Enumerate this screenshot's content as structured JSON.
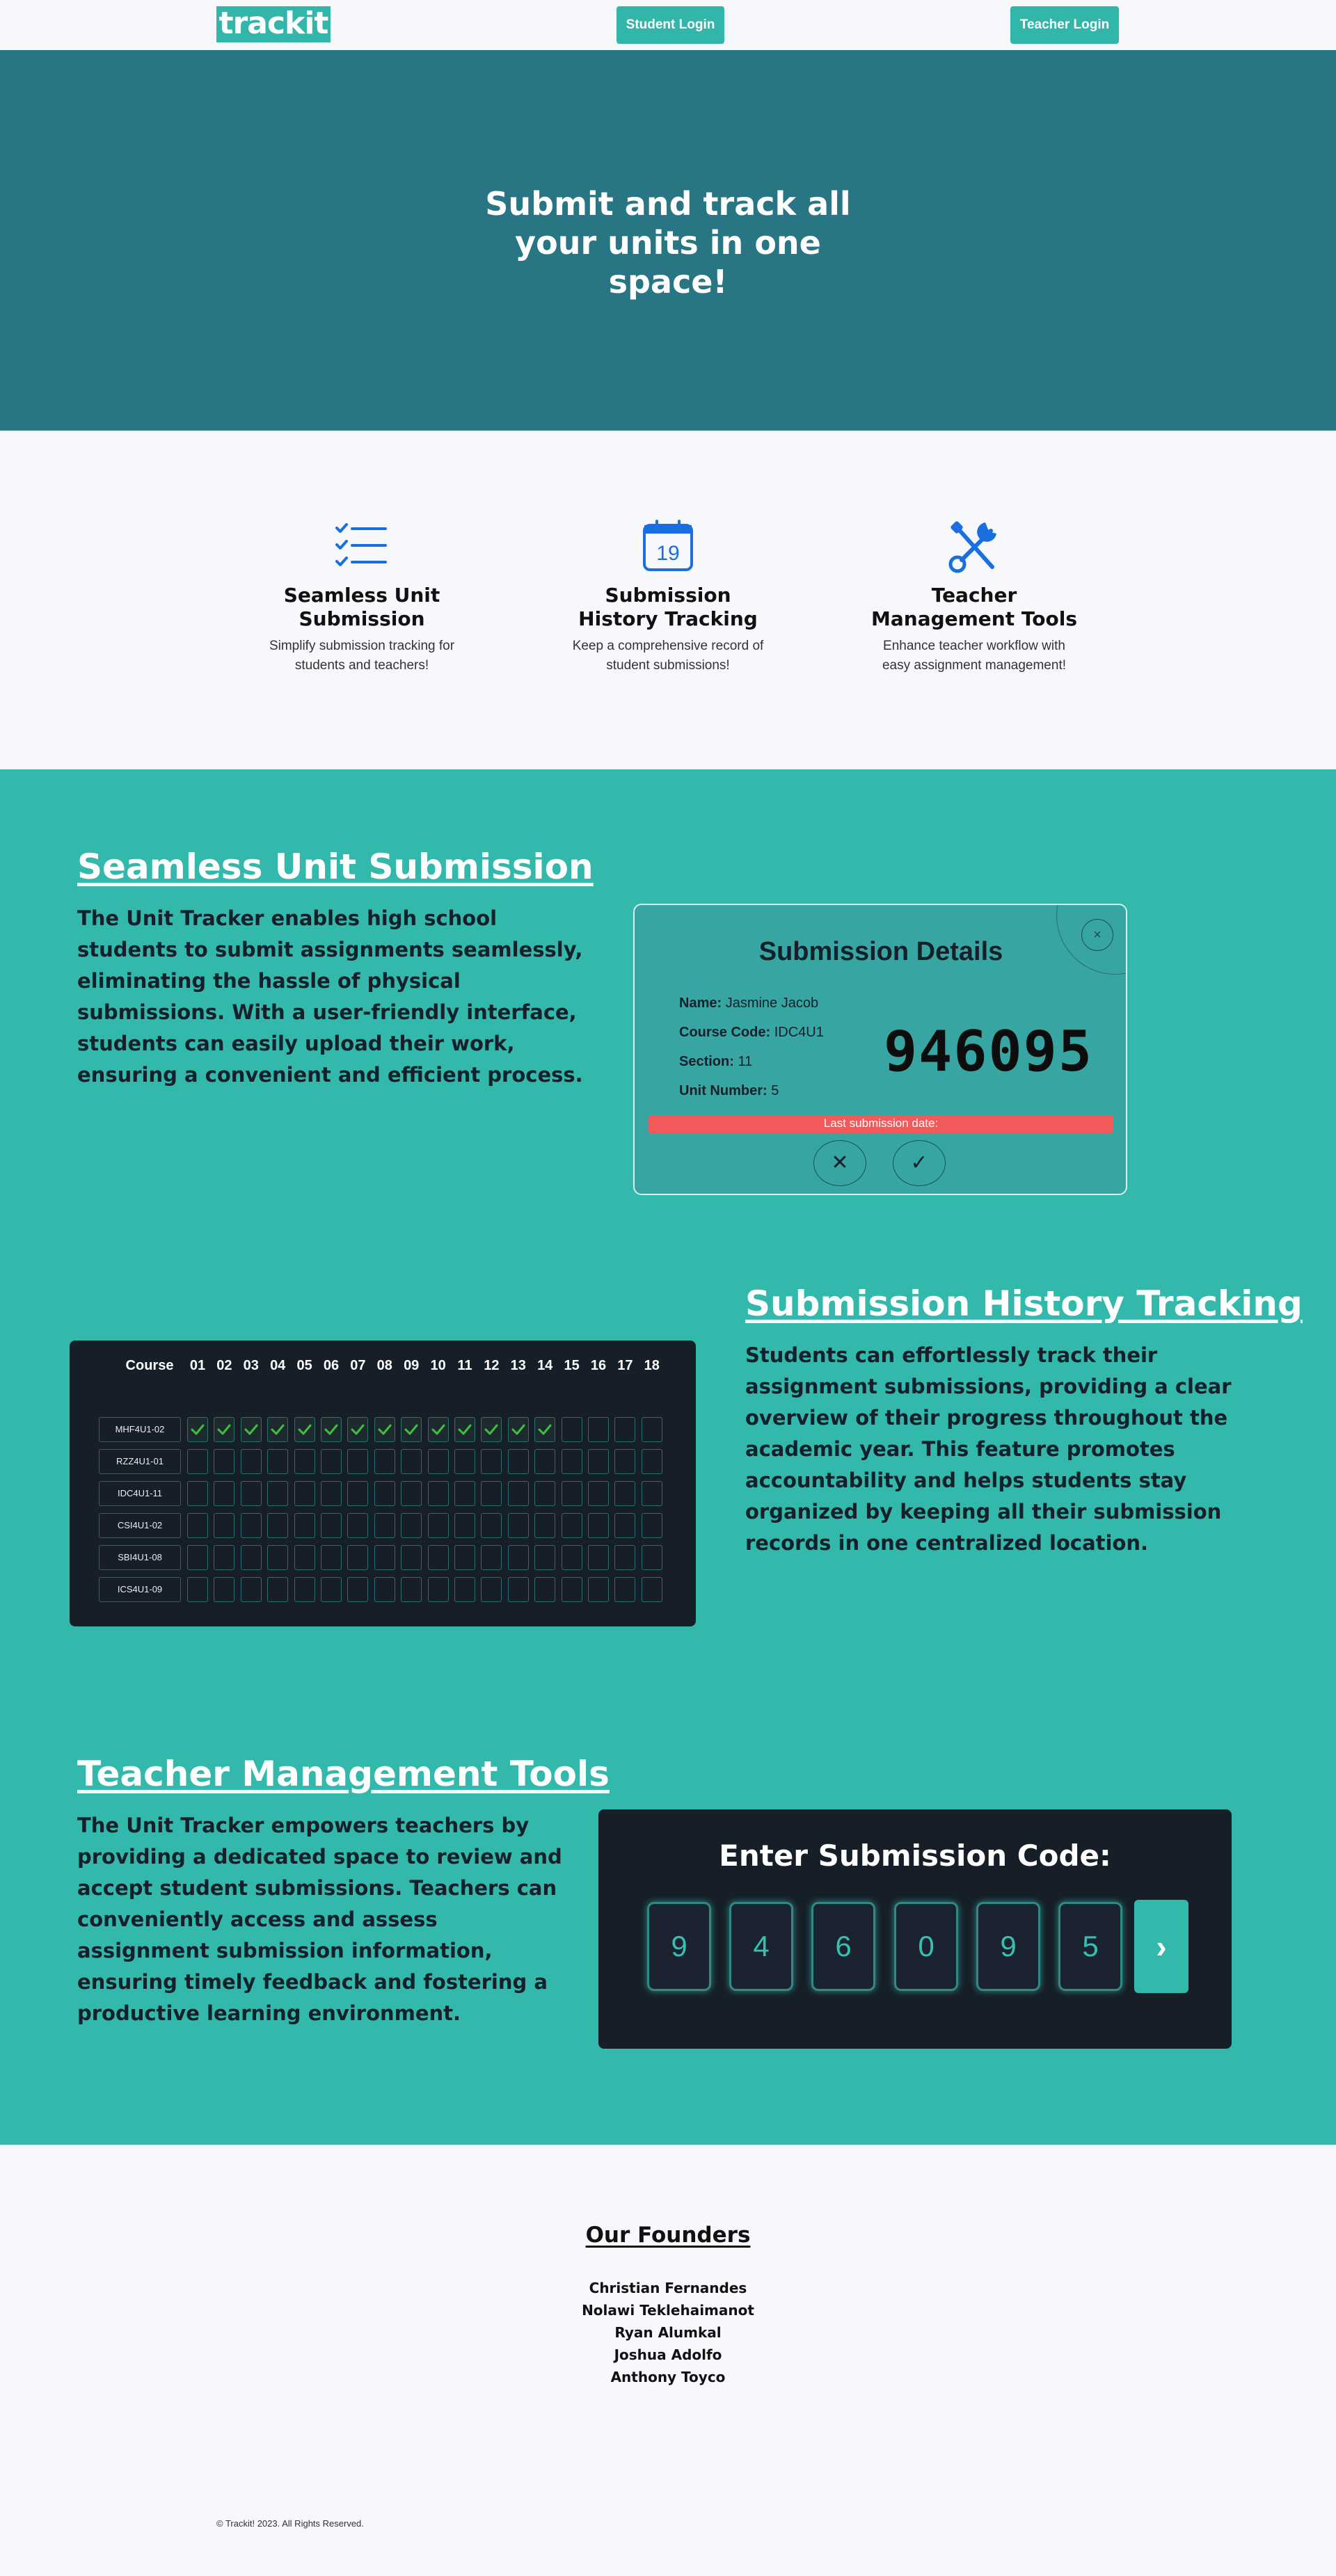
{
  "nav": {
    "logo": "trackit",
    "student_login": "Student Login",
    "teacher_login": "Teacher Login"
  },
  "hero": {
    "title": "Submit and track all your units in one space!"
  },
  "features": [
    {
      "icon": "checklist-icon",
      "title": "Seamless Unit Submission",
      "desc": "Simplify submission tracking for students and teachers!"
    },
    {
      "icon": "calendar-icon",
      "title": "Submission History Tracking",
      "desc": "Keep a comprehensive record of student submissions!",
      "calendar_day": "19"
    },
    {
      "icon": "tools-icon",
      "title": "Teacher Management Tools",
      "desc": "Enhance teacher workflow with easy assignment management!"
    }
  ],
  "section1": {
    "heading": "Seamless Unit Submission",
    "body": "The Unit Tracker enables high school students to submit assignments seamlessly, eliminating the hassle of physical submissions. With a user-friendly interface, students can easily upload their work, ensuring a convenient and efficient process."
  },
  "details_card": {
    "title": "Submission Details",
    "close": "×",
    "name_label": "Name:",
    "name": "Jasmine Jacob",
    "course_label": "Course Code:",
    "course": "IDC4U1",
    "section_label": "Section:",
    "section": "11",
    "unit_label": "Unit Number:",
    "unit": "5",
    "code": "946095",
    "last_submission": "Last submission date:",
    "reject": "✕",
    "accept": "✓"
  },
  "section2": {
    "heading": "Submission History Tracking",
    "body": "Students can effortlessly track their assignment submissions, providing a clear overview of their progress throughout the academic year. This feature promotes accountability and helps students stay organized by keeping all their submission records in one centralized location."
  },
  "history": {
    "course_header": "Course",
    "units": [
      "01",
      "02",
      "03",
      "04",
      "05",
      "06",
      "07",
      "08",
      "09",
      "10",
      "11",
      "12",
      "13",
      "14",
      "15",
      "16",
      "17",
      "18"
    ],
    "courses": [
      {
        "code": "MHF4U1-02",
        "completed": 14
      },
      {
        "code": "RZZ4U1-01",
        "completed": 0
      },
      {
        "code": "IDC4U1-11",
        "completed": 0
      },
      {
        "code": "CSI4U1-02",
        "completed": 0
      },
      {
        "code": "SBI4U1-08",
        "completed": 0
      },
      {
        "code": "ICS4U1-09",
        "completed": 0
      }
    ],
    "check_color": "#3fbf3f"
  },
  "section3": {
    "heading": "Teacher Management Tools",
    "body": "The Unit Tracker empowers teachers by providing a dedicated space to review and accept student submissions. Teachers can conveniently access and assess assignment submission information, ensuring timely feedback and fostering a productive learning environment."
  },
  "code_entry": {
    "title": "Enter Submission Code:",
    "digits": [
      "9",
      "4",
      "6",
      "0",
      "9",
      "5"
    ],
    "submit": "›"
  },
  "founders": {
    "heading": "Our Founders",
    "names": [
      "Christian Fernandes",
      "Nolawi Teklehaimanot",
      "Ryan Alumkal",
      "Joshua Adolfo",
      "Anthony Toyco"
    ]
  },
  "footer": {
    "copyright": "© Trackit! 2023. All Rights Reserved."
  },
  "colors": {
    "accent": "#33b8ac",
    "hero": "#287584",
    "dark_panel": "#161e27",
    "icon_blue": "#1a6fe0",
    "alert": "#f15a5a"
  }
}
